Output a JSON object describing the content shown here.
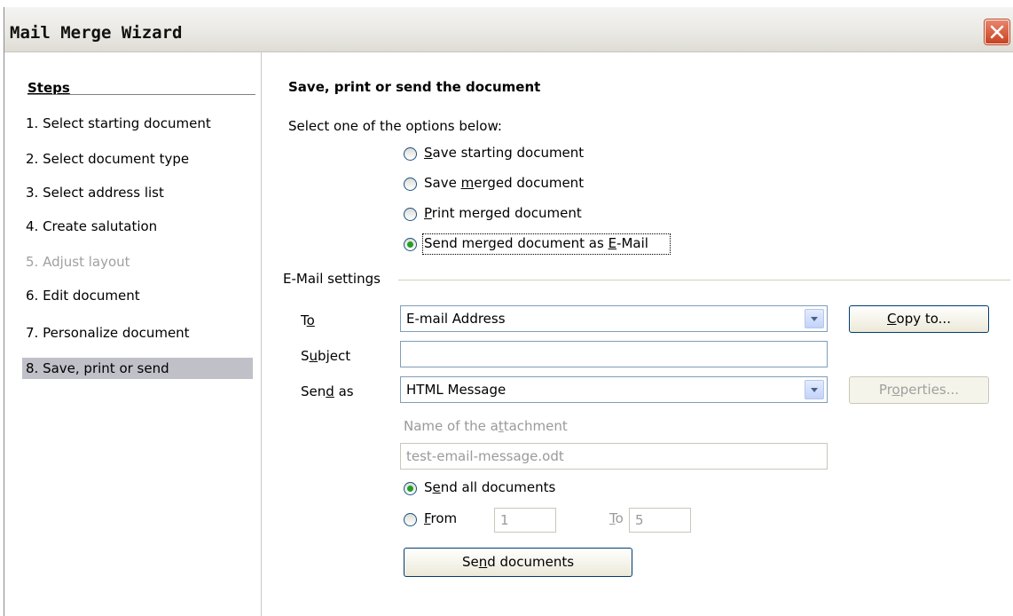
{
  "window": {
    "title": "Mail Merge Wizard"
  },
  "steps": {
    "heading": "Steps",
    "items": [
      {
        "label": "1.  Select starting document"
      },
      {
        "label": "2.  Select document type"
      },
      {
        "label": "3.  Select address list"
      },
      {
        "label": "4.  Create salutation"
      },
      {
        "label": "5.  Adjust layout"
      },
      {
        "label": "6.  Edit document"
      },
      {
        "label": "7.  Personalize document"
      },
      {
        "label": "8.  Save, print or send"
      }
    ],
    "active_index": 8,
    "disabled_index": 5
  },
  "main": {
    "heading": "Save, print or send the document",
    "prompt": "Select one of the options below:",
    "options": [
      {
        "pre": "",
        "u": "S",
        "post": "ave starting document",
        "selected": false
      },
      {
        "pre": "Save ",
        "u": "m",
        "post": "erged document",
        "selected": false
      },
      {
        "pre": "",
        "u": "P",
        "post": "rint merged document",
        "selected": false
      },
      {
        "pre": "Send merged document as ",
        "u": "E",
        "post": "-Mail",
        "selected": true
      }
    ]
  },
  "email": {
    "section_label": "E-Mail settings",
    "to": {
      "pre": "T",
      "u": "o",
      "post": "",
      "value": "E-mail Address"
    },
    "copy_to": {
      "pre": "",
      "u": "C",
      "post": "opy to..."
    },
    "subject": {
      "pre": "S",
      "u": "u",
      "post": "bject",
      "value": ""
    },
    "send_as": {
      "pre": "Sen",
      "u": "d",
      "post": " as",
      "value": "HTML Message"
    },
    "properties": {
      "pre": "Pr",
      "u": "o",
      "post": "perties..."
    },
    "attachment": {
      "pre": "Name of the a",
      "u": "t",
      "post": "tachment",
      "value": "test-email-message.odt"
    },
    "send_all": {
      "pre": "S",
      "u": "e",
      "post": "nd all documents",
      "selected": true
    },
    "from": {
      "pre": "",
      "u": "F",
      "post": "rom",
      "value": "1",
      "selected": false
    },
    "to_range": {
      "pre": "",
      "u": "T",
      "post": "o",
      "value": "5"
    },
    "send_docs": {
      "pre": "Se",
      "u": "n",
      "post": "d documents"
    }
  },
  "colors": {
    "active_step_bg": "#c0c0c8",
    "close_red": "#c8421f",
    "radio_green": "#21a121"
  }
}
